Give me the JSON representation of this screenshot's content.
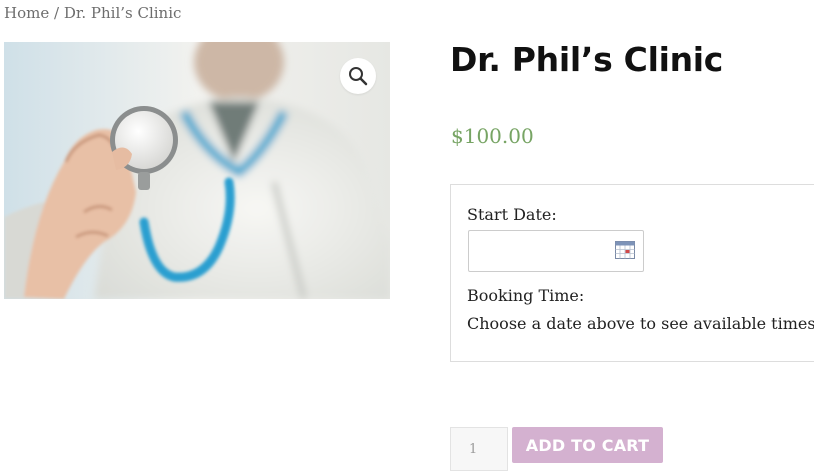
{
  "breadcrumb": {
    "home": "Home",
    "separator": " / ",
    "current": "Dr. Phil’s Clinic"
  },
  "product": {
    "title": "Dr. Phil’s Clinic",
    "price": "$100.00",
    "image_icon": "zoom-icon"
  },
  "booking": {
    "start_date_label": "Start Date:",
    "start_date_value": "",
    "booking_time_label": "Booking Time:",
    "booking_time_hint": "Choose a date above to see available times."
  },
  "cart": {
    "quantity": "1",
    "add_to_cart_label": "ADD TO CART"
  },
  "colors": {
    "price": "#77a464",
    "button": "#d4b1d0"
  }
}
